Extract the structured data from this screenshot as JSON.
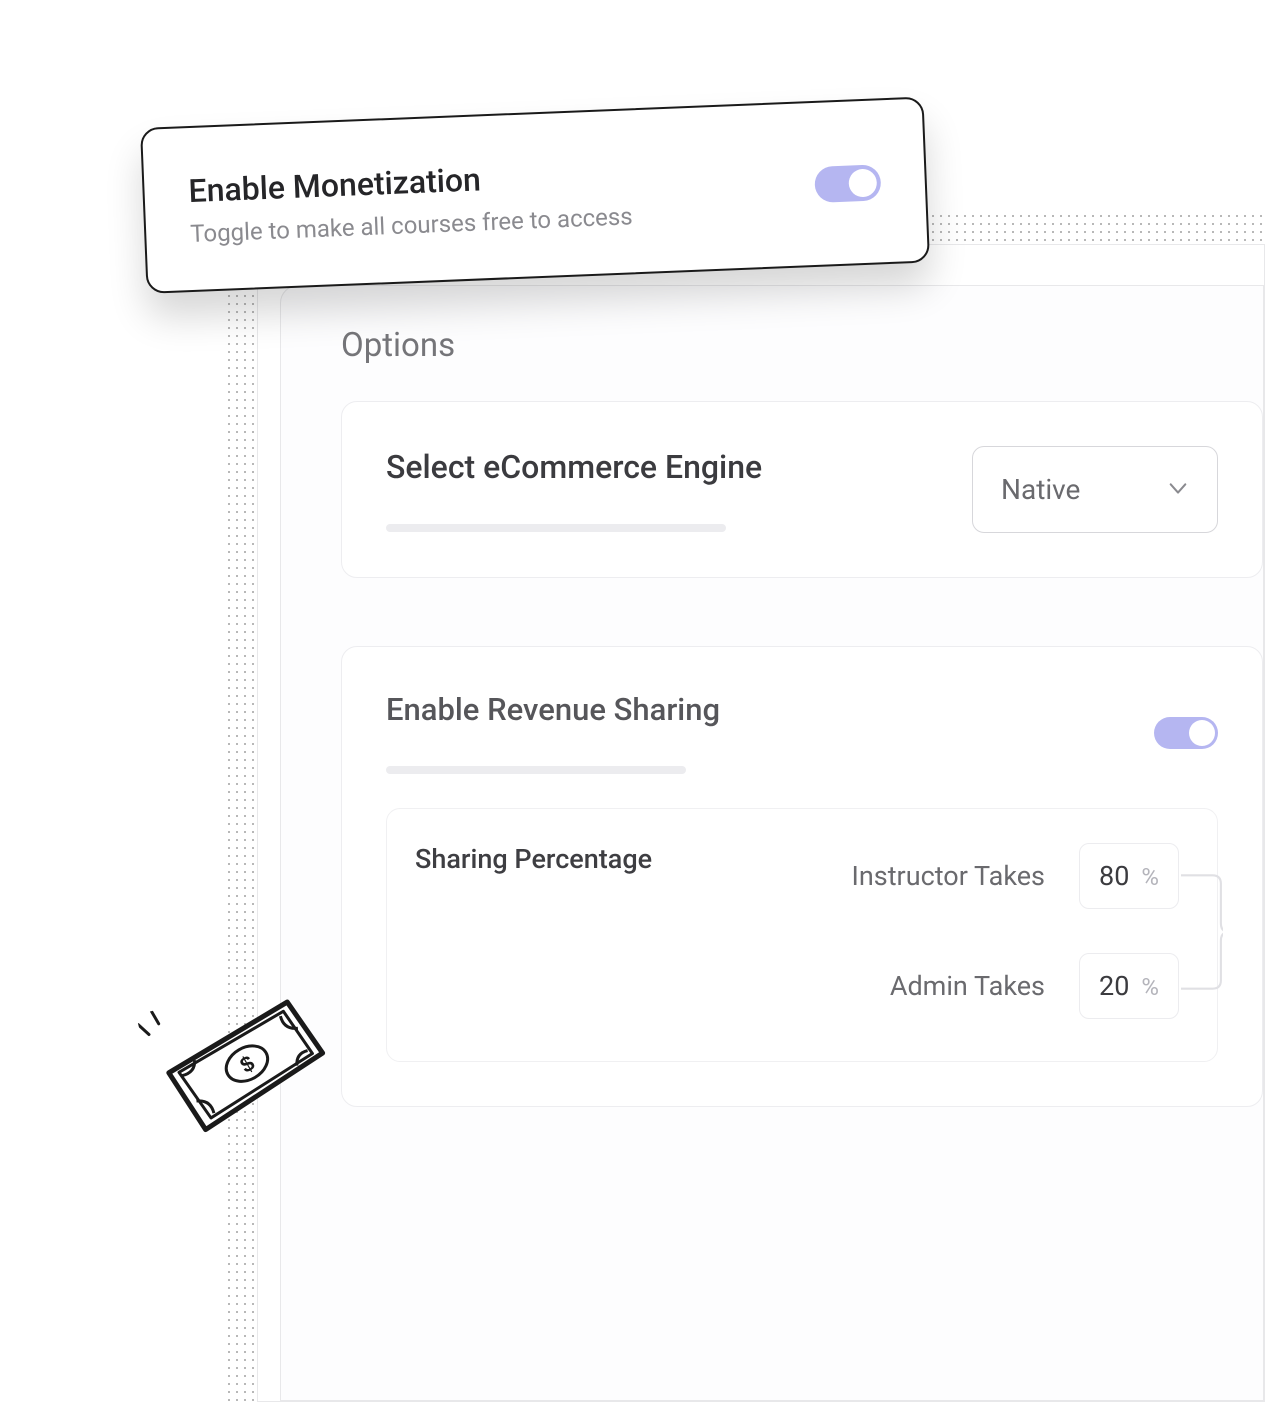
{
  "monetization": {
    "title": "Enable Monetization",
    "subtitle": "Toggle to make all courses free to access",
    "enabled": true
  },
  "options": {
    "heading": "Options",
    "ecommerce": {
      "label": "Select eCommerce Engine",
      "selected": "Native"
    },
    "revenue_sharing": {
      "label": "Enable Revenue Sharing",
      "enabled": true,
      "sharing": {
        "title": "Sharing Percentage",
        "instructor_label": "Instructor Takes",
        "instructor_value": "80",
        "admin_label": "Admin Takes",
        "admin_value": "20",
        "percent_sign": "%"
      }
    }
  }
}
